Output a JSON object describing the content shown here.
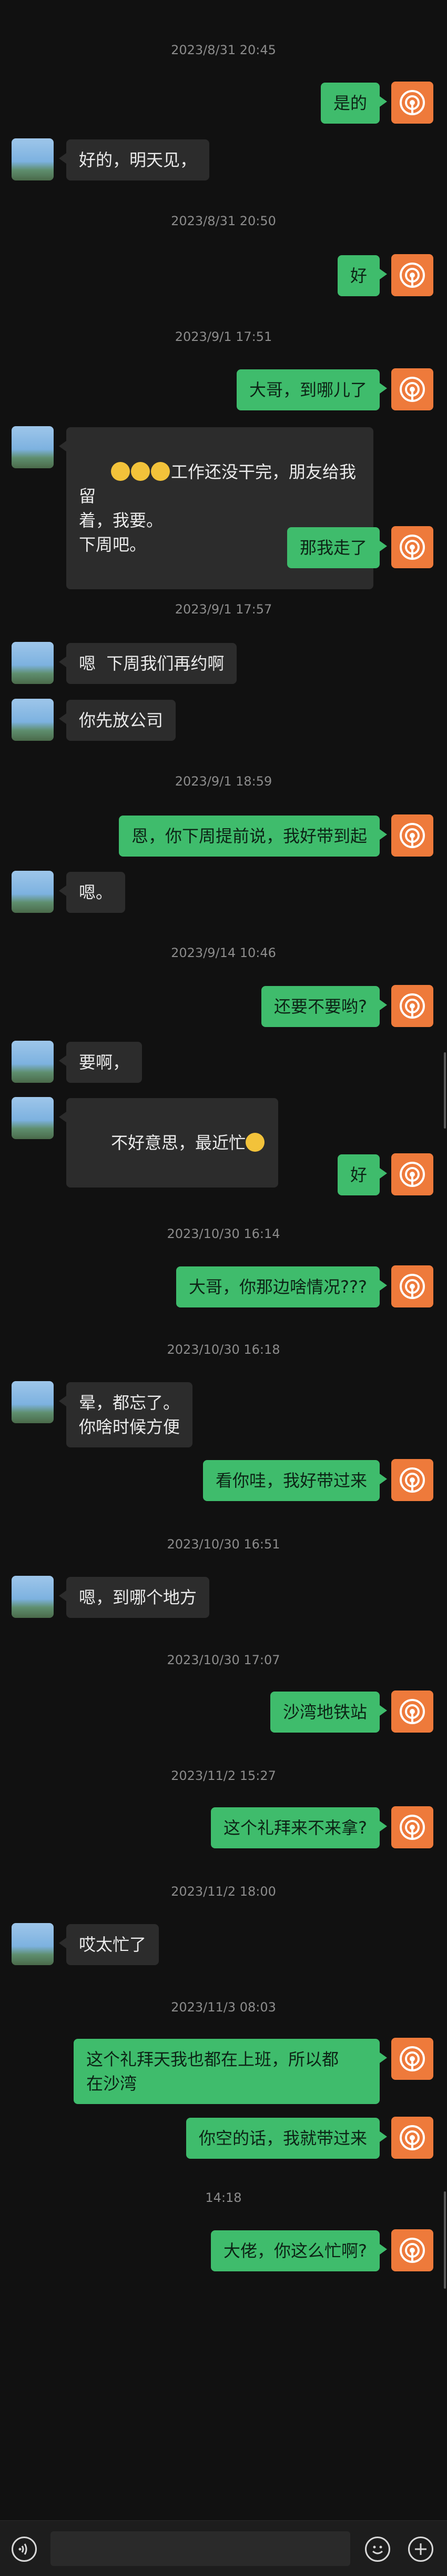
{
  "timestamps": [
    "2023/8/31 20:45",
    "2023/8/31 20:50",
    "2023/9/1 17:51",
    "2023/9/1 17:57",
    "2023/9/1 18:59",
    "2023/9/14 10:46",
    "2023/10/30 16:14",
    "2023/10/30 16:18",
    "2023/10/30 16:51",
    "2023/10/30 17:07",
    "2023/11/2 15:27",
    "2023/11/2 18:00",
    "2023/11/3 08:03",
    "14:18"
  ],
  "messages": [
    {
      "side": "out",
      "text": "是的"
    },
    {
      "side": "in",
      "text": "好的，明天见，"
    },
    {
      "side": "out",
      "text": "好"
    },
    {
      "side": "out",
      "text": "大哥，到哪儿了"
    },
    {
      "side": "in",
      "text": "工作还没干完，朋友给我留\n着，我要。\n下周吧。"
    },
    {
      "side": "out",
      "text": "那我走了"
    },
    {
      "side": "in",
      "text": "嗯  下周我们再约啊"
    },
    {
      "side": "in",
      "text": "你先放公司"
    },
    {
      "side": "out",
      "text": "恩，你下周提前说，我好带到起"
    },
    {
      "side": "in",
      "text": "嗯。"
    },
    {
      "side": "out",
      "text": "还要不要哟?"
    },
    {
      "side": "in",
      "text": "要啊，"
    },
    {
      "side": "in",
      "text": "不好意思，最近忙"
    },
    {
      "side": "out",
      "text": "好"
    },
    {
      "side": "out",
      "text": "大哥，你那边啥情况???"
    },
    {
      "side": "in",
      "text": "晕，都忘了。\n你啥时候方便"
    },
    {
      "side": "out",
      "text": "看你哇，我好带过来"
    },
    {
      "side": "in",
      "text": "嗯，到哪个地方"
    },
    {
      "side": "out",
      "text": "沙湾地铁站"
    },
    {
      "side": "out",
      "text": "这个礼拜来不来拿?"
    },
    {
      "side": "in",
      "text": "哎太忙了"
    },
    {
      "side": "out",
      "text": "这个礼拜天我也都在上班，所以都\n在沙湾"
    },
    {
      "side": "out",
      "text": "你空的话，我就带过来"
    },
    {
      "side": "out",
      "text": "大佬，你这么忙啊?"
    }
  ],
  "icons": {
    "my_avatar": "podcast-icon",
    "voice": "voice-icon",
    "emoji": "emoji-icon",
    "more": "plus-icon"
  },
  "colors": {
    "background": "#111111",
    "bubble_out": "#3fbc6c",
    "bubble_in": "#2c2c2c",
    "my_avatar": "#ee7a3b"
  }
}
